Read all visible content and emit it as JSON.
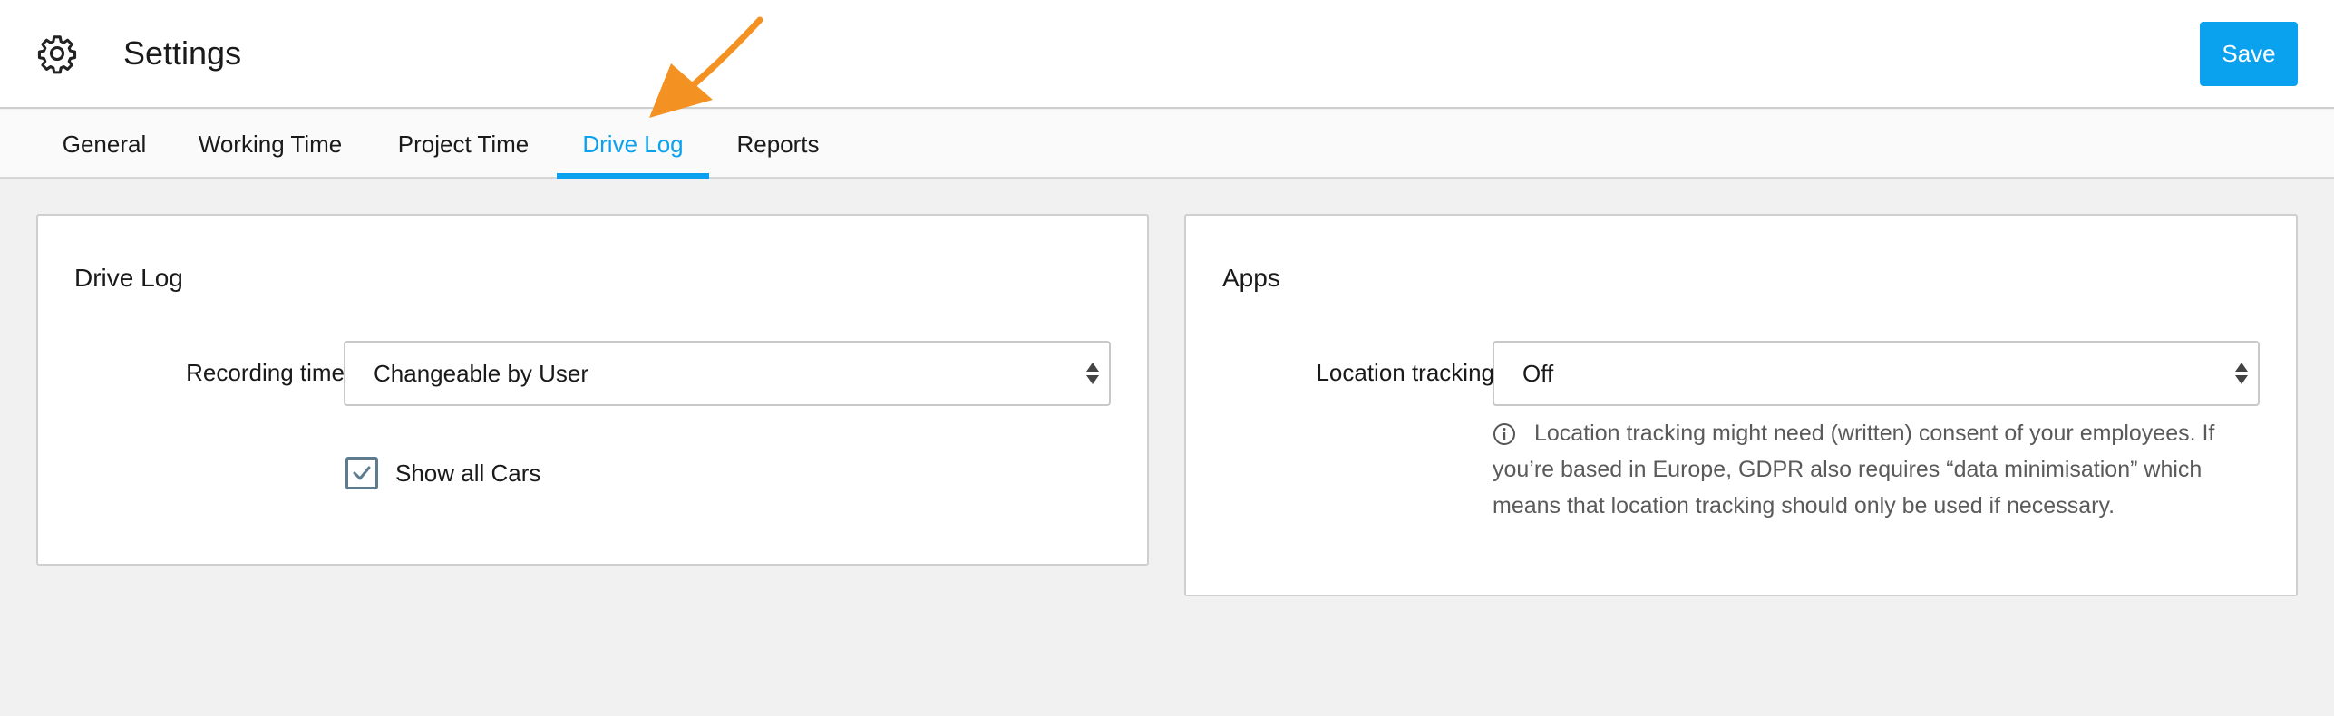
{
  "header": {
    "icon": "gear-icon",
    "title": "Settings",
    "save_label": "Save"
  },
  "tabs": [
    {
      "label": "General",
      "active": false
    },
    {
      "label": "Working Time",
      "active": false
    },
    {
      "label": "Project Time",
      "active": false
    },
    {
      "label": "Drive Log",
      "active": true
    },
    {
      "label": "Reports",
      "active": false
    }
  ],
  "drive_log_card": {
    "title": "Drive Log",
    "recording_time_label": "Recording time",
    "recording_time_value": "Changeable by User",
    "show_all_cars_label": "Show all Cars",
    "show_all_cars_checked": true
  },
  "apps_card": {
    "title": "Apps",
    "location_tracking_label": "Location tracking",
    "location_tracking_value": "Off",
    "info_icon": "info-icon",
    "info_text": "Location tracking might need (written) consent of your employees. If you’re based in Europe, GDPR also requires “data minimisation” which means that location tracking should only be used if necessary."
  },
  "colors": {
    "accent": "#0aa2ee",
    "annotation_arrow": "#f39223",
    "background": "#f1f1f1"
  }
}
